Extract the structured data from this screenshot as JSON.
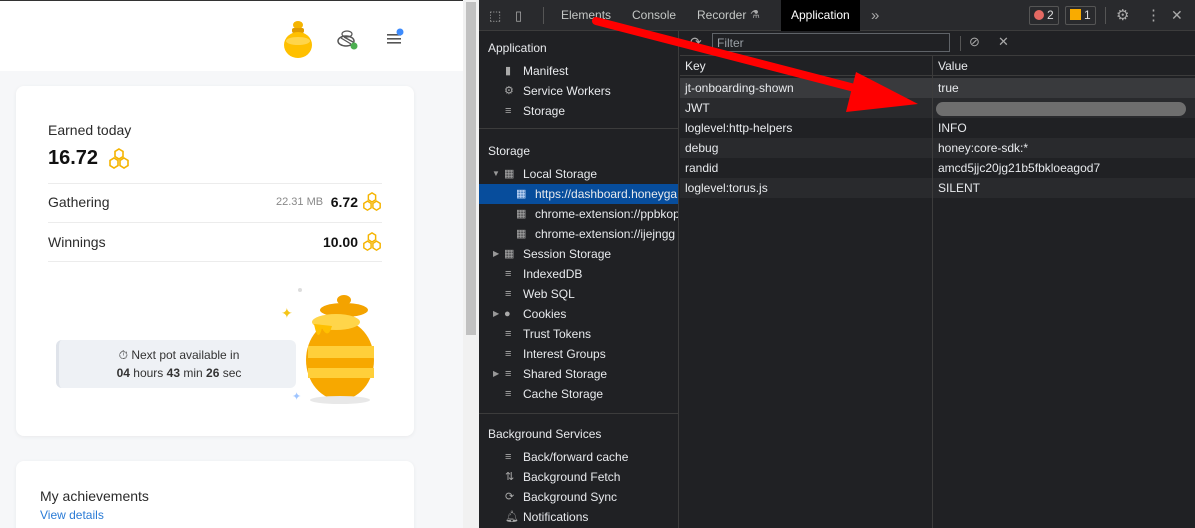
{
  "left_page": {
    "earned": {
      "label": "Earned today",
      "value": "16.72"
    },
    "gathering": {
      "label": "Gathering",
      "size": "22.31 MB",
      "value": "6.72"
    },
    "winnings": {
      "label": "Winnings",
      "value": "10.00"
    },
    "pot": {
      "prefix": "Next pot available in",
      "hours": "04",
      "hours_label": "hours",
      "minutes": "43",
      "minutes_label": "min",
      "seconds": "26",
      "seconds_label": "sec"
    },
    "achievements": {
      "title": "My achievements",
      "link": "View details"
    }
  },
  "devtools": {
    "tabs": [
      "Elements",
      "Console",
      "Recorder",
      "Application"
    ],
    "active_tab": "Application",
    "errors": "2",
    "warnings": "1",
    "sidebar": {
      "application_title": "Application",
      "application_items": [
        "Manifest",
        "Service Workers",
        "Storage"
      ],
      "storage_title": "Storage",
      "local_storage": "Local Storage",
      "local_storage_children": [
        "https://dashboard.honeyga",
        "chrome-extension://ppbkop",
        "chrome-extension://ijejngg"
      ],
      "storage_items": [
        "Session Storage",
        "IndexedDB",
        "Web SQL",
        "Cookies",
        "Trust Tokens",
        "Interest Groups",
        "Shared Storage",
        "Cache Storage"
      ],
      "background_title": "Background Services",
      "background_items": [
        "Back/forward cache",
        "Background Fetch",
        "Background Sync",
        "Notifications"
      ]
    },
    "filter_placeholder": "Filter",
    "table": {
      "headers": [
        "Key",
        "Value"
      ],
      "rows": [
        {
          "key": "jt-onboarding-shown",
          "value": "true"
        },
        {
          "key": "JWT",
          "value": ""
        },
        {
          "key": "loglevel:http-helpers",
          "value": "INFO"
        },
        {
          "key": "debug",
          "value": "honey:core-sdk:*"
        },
        {
          "key": "randid",
          "value": "amcd5jjc20jg21b5fbkloeagod7"
        },
        {
          "key": "loglevel:torus.js",
          "value": "SILENT"
        }
      ]
    }
  },
  "colors": {
    "accent_gold": "#f5b400",
    "devtools_bg": "#202124",
    "selection": "#074d9c",
    "arrow": "#ff0000"
  }
}
